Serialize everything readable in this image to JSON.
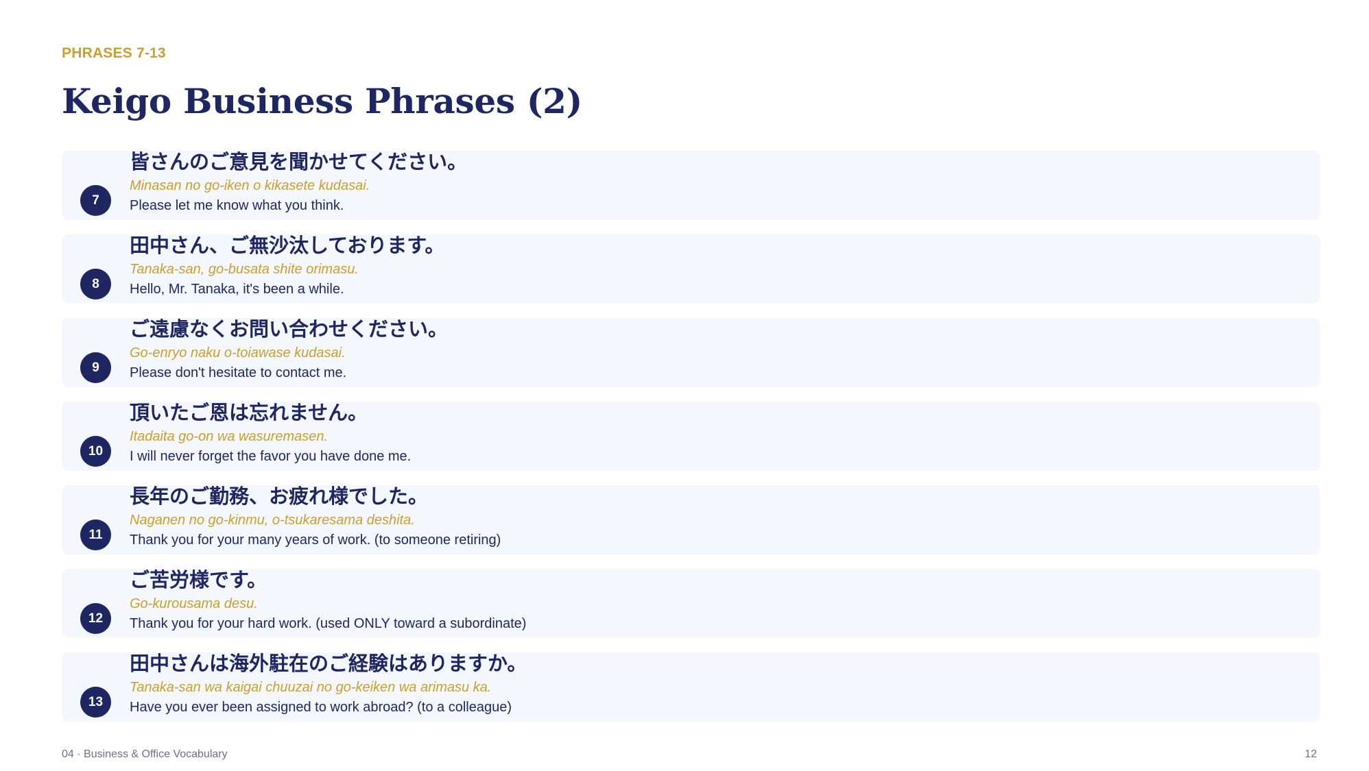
{
  "header": {
    "kicker": "PHRASES 7-13",
    "title": "Keigo Business Phrases (2)"
  },
  "phrases": [
    {
      "number": "7",
      "japanese": "皆さんのご意見を聞かせてください。",
      "romaji": "Minasan no go-iken o kikasete kudasai.",
      "english": "Please let me know what you think."
    },
    {
      "number": "8",
      "japanese": "田中さん、ご無沙汰しております。",
      "romaji": "Tanaka-san, go-busata shite orimasu.",
      "english": "Hello, Mr. Tanaka, it's been a while."
    },
    {
      "number": "9",
      "japanese": "ご遠慮なくお問い合わせください。",
      "romaji": "Go-enryo naku o-toiawase kudasai.",
      "english": "Please don't hesitate to contact me."
    },
    {
      "number": "10",
      "japanese": "頂いたご恩は忘れません。",
      "romaji": "Itadaita go-on wa wasuremasen.",
      "english": "I will never forget the favor you have done me."
    },
    {
      "number": "11",
      "japanese": "長年のご勤務、お疲れ様でした。",
      "romaji": "Naganen no go-kinmu, o-tsukaresama deshita.",
      "english": "Thank you for your many years of work. (to someone retiring)"
    },
    {
      "number": "12",
      "japanese": "ご苦労様です。",
      "romaji": "Go-kurousama desu.",
      "english": "Thank you for your hard work. (used ONLY toward a subordinate)"
    },
    {
      "number": "13",
      "japanese": "田中さんは海外駐在のご経験はありますか。",
      "romaji": "Tanaka-san wa kaigai chuuzai no go-keiken wa arimasu ka.",
      "english": "Have you ever been assigned to work abroad? (to a colleague)"
    }
  ],
  "footer": {
    "section": "04 · Business & Office Vocabulary",
    "page_number": "12"
  },
  "colors": {
    "navy": "#1e2761",
    "gold": "#c9a02e",
    "card_background": "#f4f7fd"
  }
}
